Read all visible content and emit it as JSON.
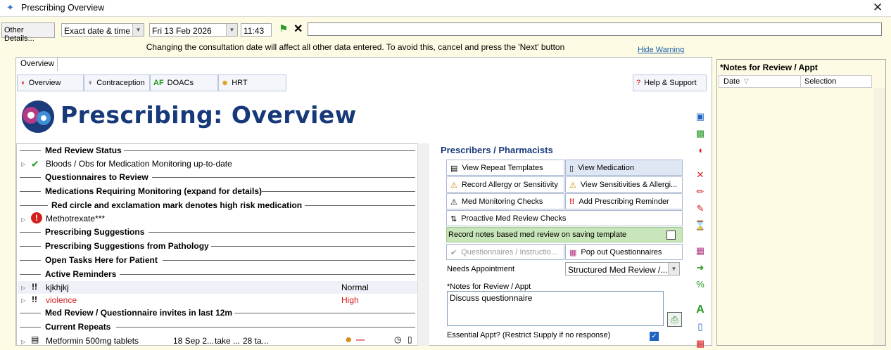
{
  "window": {
    "title": "Prescribing Overview"
  },
  "toolbar": {
    "other_details": "Other Details...",
    "date_mode": "Exact date & time",
    "date": "Fri 13 Feb 2026",
    "time": "11:43"
  },
  "warning": {
    "text": "Changing the consultation date will affect all other data entered. To avoid this, cancel and press the 'Next' button",
    "hide": "Hide Warning"
  },
  "tabs": [
    "Overview"
  ],
  "subtabs": [
    "Overview",
    "Contraception",
    "DOACs",
    "HRT"
  ],
  "help": "Help & Support",
  "page_title": "Prescribing: Overview",
  "tree": {
    "med_review_status": "Med Review Status",
    "bloods": "Bloods / Obs for Medication Monitoring up-to-date",
    "questionnaires": "Questionnaires to Review",
    "monitoring": "Medications Requiring Monitoring (expand for details)",
    "highrisk_note": "Red circle and exclamation mark denotes high risk medication",
    "methotrexate": "Methotrexate***",
    "suggestions": "Prescribing Suggestions",
    "suggestions_path": "Prescribing Suggestions from Pathology",
    "open_tasks": "Open Tasks Here for Patient",
    "active_reminders": "Active Reminders",
    "reminders": [
      {
        "name": "kjkhjkj",
        "priority": "Normal"
      },
      {
        "name": "violence",
        "priority": "High"
      }
    ],
    "invites": "Med Review / Questionnaire invites in last 12m",
    "current_repeats": "Current Repeats",
    "repeat": {
      "drug": "Metformin 500mg tablets",
      "date": "18 Sep 2...",
      "dose": "take ...",
      "qty": "28 ta..."
    }
  },
  "prescribers": {
    "heading": "Prescribers / Pharmacists",
    "view_repeat": "View Repeat Templates",
    "view_med": "View Medication",
    "record_allergy": "Record Allergy or Sensitivity",
    "view_sens": "View Sensitivities & Allergi...",
    "monitoring_checks": "Med Monitoring Checks",
    "add_reminder": "Add Prescribing Reminder",
    "proactive": "Proactive Med Review Checks",
    "record_notes": "Record notes based med review on saving template",
    "questionnaires_btn": "Questionnaires / Instructio...",
    "popout": "Pop out Questionnaires",
    "needs_appt_label": "Needs Appointment",
    "needs_appt_value": "Structured Med Review /...",
    "notes_label": "*Notes for Review / Appt",
    "notes_value": "Discuss questionnaire",
    "essential": "Essential Appt? (Restrict Supply if no response)"
  },
  "right": {
    "title": "*Notes for Review / Appt",
    "col_date": "Date",
    "col_sel": "Selection"
  }
}
